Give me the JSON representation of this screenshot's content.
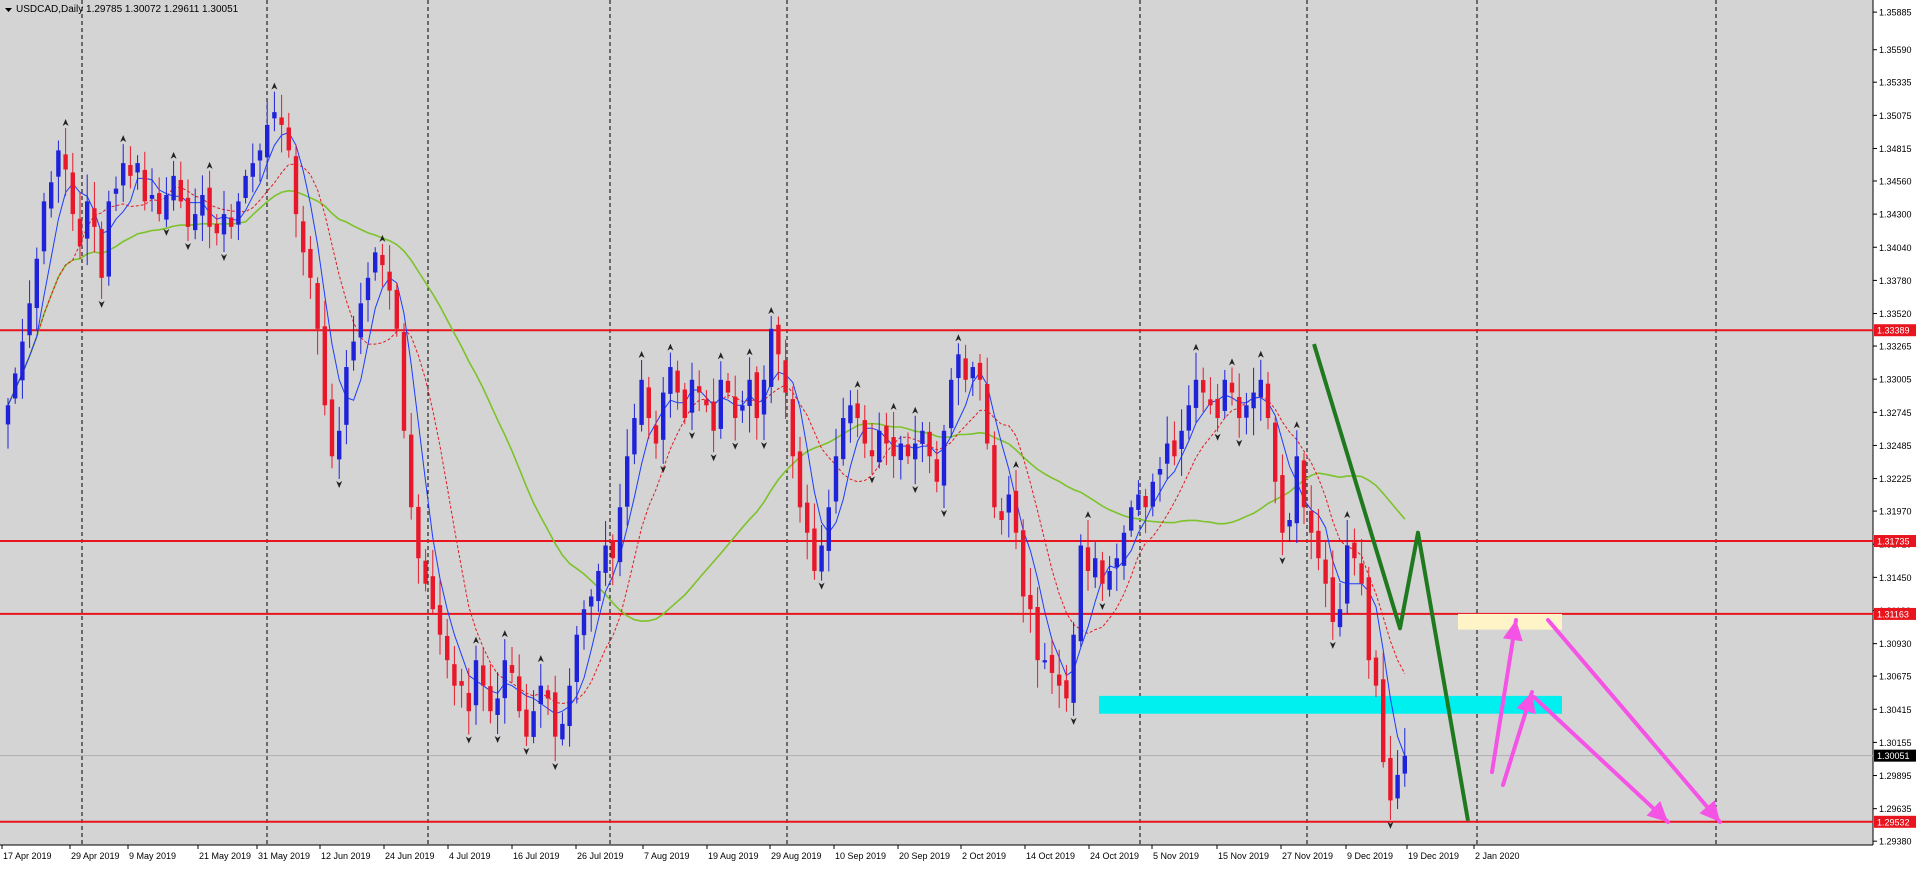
{
  "header": {
    "dropdown_icon": "triangle-down-icon",
    "text": "USDCAD,Daily  1.29785 1.30072 1.29611 1.30051"
  },
  "colors": {
    "background": "#d4d4d4",
    "bull_candle": "#1e22d8",
    "bear_candle": "#e8182a",
    "ma_fast": "#1a3cff",
    "ma_mid": "#e31b23",
    "ma_slow": "#7cc329",
    "level_line": "#e8141e",
    "zone_cyan": "#00f0f0",
    "zone_cream": "#fff4c8",
    "wave_green": "#1f7a1f",
    "projection_arrow": "#f552e6",
    "current_price_tag": "#000000"
  },
  "chart_data": {
    "type": "candlestick",
    "symbol": "USDCAD",
    "timeframe": "Daily",
    "ohlc_current": {
      "open": 1.29785,
      "high": 1.30072,
      "low": 1.29611,
      "close": 1.30051
    },
    "ylim": [
      1.2935,
      1.3598
    ],
    "y_ticks": [
      "1.35885",
      "1.35590",
      "1.35335",
      "1.35075",
      "1.34815",
      "1.34560",
      "1.34300",
      "1.34040",
      "1.33780",
      "1.33520",
      "1.33265",
      "1.33005",
      "1.32745",
      "1.32485",
      "1.32225",
      "1.31970",
      "1.31710",
      "1.31450",
      "1.31190",
      "1.30930",
      "1.30675",
      "1.30415",
      "1.30155",
      "1.29895",
      "1.29635",
      "1.29380"
    ],
    "x_ticks": [
      "17 Apr 2019",
      "29 Apr 2019",
      "9 May 2019",
      "21 May 2019",
      "31 May 2019",
      "12 Jun 2019",
      "24 Jun 2019",
      "4 Jul 2019",
      "16 Jul 2019",
      "26 Jul 2019",
      "7 Aug 2019",
      "19 Aug 2019",
      "29 Aug 2019",
      "10 Sep 2019",
      "20 Sep 2019",
      "2 Oct 2019",
      "14 Oct 2019",
      "24 Oct 2019",
      "5 Nov 2019",
      "15 Nov 2019",
      "27 Nov 2019",
      "9 Dec 2019",
      "19 Dec 2019",
      "2 Jan 2020"
    ],
    "horizontal_levels": [
      {
        "price": 1.33389,
        "label": "1.33389"
      },
      {
        "price": 1.31735,
        "label": "1.31735"
      },
      {
        "price": 1.31163,
        "label": "1.31163"
      },
      {
        "price": 1.29532,
        "label": "1.29532"
      }
    ],
    "current_price_label": "1.30051",
    "candles_close": [
      1.328,
      1.3305,
      1.333,
      1.336,
      1.3395,
      1.344,
      1.3455,
      1.348,
      1.3465,
      1.343,
      1.3405,
      1.344,
      1.342,
      1.338,
      1.344,
      1.345,
      1.347,
      1.346,
      1.347,
      1.344,
      1.3445,
      1.343,
      1.3445,
      1.346,
      1.344,
      1.342,
      1.343,
      1.3445,
      1.342,
      1.3415,
      1.343,
      1.342,
      1.344,
      1.346,
      1.347,
      1.348,
      1.35,
      1.351,
      1.35,
      1.348,
      1.343,
      1.34,
      1.338,
      1.334,
      1.328,
      1.324,
      1.326,
      1.331,
      1.333,
      1.336,
      1.338,
      1.34,
      1.339,
      1.337,
      1.334,
      1.326,
      1.32,
      1.316,
      1.314,
      1.312,
      1.31,
      1.308,
      1.306,
      1.306,
      1.304,
      1.308,
      1.306,
      1.304,
      1.305,
      1.308,
      1.307,
      1.304,
      1.302,
      1.304,
      1.306,
      1.305,
      1.302,
      1.303,
      1.306,
      1.31,
      1.312,
      1.313,
      1.315,
      1.317,
      1.316,
      1.32,
      1.324,
      1.327,
      1.33,
      1.327,
      1.325,
      1.329,
      1.331,
      1.329,
      1.327,
      1.33,
      1.329,
      1.328,
      1.326,
      1.33,
      1.329,
      1.327,
      1.328,
      1.33,
      1.327,
      1.33,
      1.334,
      1.332,
      1.329,
      1.324,
      1.32,
      1.318,
      1.315,
      1.317,
      1.32,
      1.324,
      1.327,
      1.328,
      1.327,
      1.325,
      1.324,
      1.326,
      1.325,
      1.324,
      1.325,
      1.324,
      1.325,
      1.326,
      1.324,
      1.322,
      1.326,
      1.33,
      1.332,
      1.33,
      1.331,
      1.33,
      1.325,
      1.32,
      1.319,
      1.321,
      1.318,
      1.313,
      1.312,
      1.308,
      1.308,
      1.307,
      1.306,
      1.305,
      1.31,
      1.317,
      1.315,
      1.316,
      1.314,
      1.315,
      1.316,
      1.318,
      1.32,
      1.321,
      1.32,
      1.322,
      1.323,
      1.325,
      1.324,
      1.326,
      1.328,
      1.33,
      1.329,
      1.328,
      1.327,
      1.33,
      1.329,
      1.327,
      1.328,
      1.329,
      1.33,
      1.327,
      1.322,
      1.318,
      1.319,
      1.324,
      1.32,
      1.318,
      1.316,
      1.314,
      1.311,
      1.312,
      1.317,
      1.316,
      1.314,
      1.308,
      1.306,
      1.3,
      1.297,
      1.299,
      1.3005
    ]
  }
}
